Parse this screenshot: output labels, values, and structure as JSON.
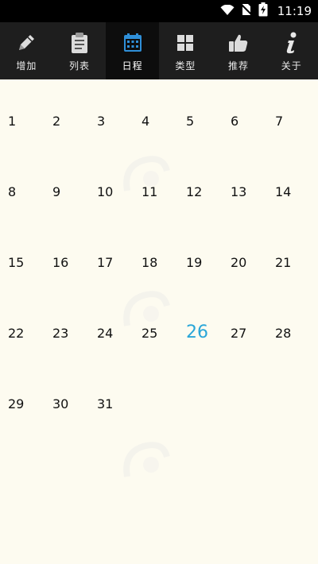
{
  "status_bar": {
    "time": "11:19"
  },
  "tabs": [
    {
      "label": "增加",
      "icon": "pencil-icon"
    },
    {
      "label": "列表",
      "icon": "clipboard-icon"
    },
    {
      "label": "日程",
      "icon": "calendar-icon",
      "active": true
    },
    {
      "label": "类型",
      "icon": "grid-icon"
    },
    {
      "label": "推荐",
      "icon": "thumbs-up-icon"
    },
    {
      "label": "关于",
      "icon": "info-icon"
    }
  ],
  "calendar": {
    "today": "26",
    "weeks": [
      [
        "1",
        "2",
        "3",
        "4",
        "5",
        "6",
        "7"
      ],
      [
        "8",
        "9",
        "10",
        "11",
        "12",
        "13",
        "14"
      ],
      [
        "15",
        "16",
        "17",
        "18",
        "19",
        "20",
        "21"
      ],
      [
        "22",
        "23",
        "24",
        "25",
        "26",
        "27",
        "28"
      ],
      [
        "29",
        "30",
        "31"
      ]
    ]
  },
  "colors": {
    "background": "#fdfbf0",
    "tab_bar": "#1e1e1e",
    "tab_active": "#0d0d0d",
    "today": "#2aa6d8",
    "active_icon": "#2f8fd8"
  }
}
